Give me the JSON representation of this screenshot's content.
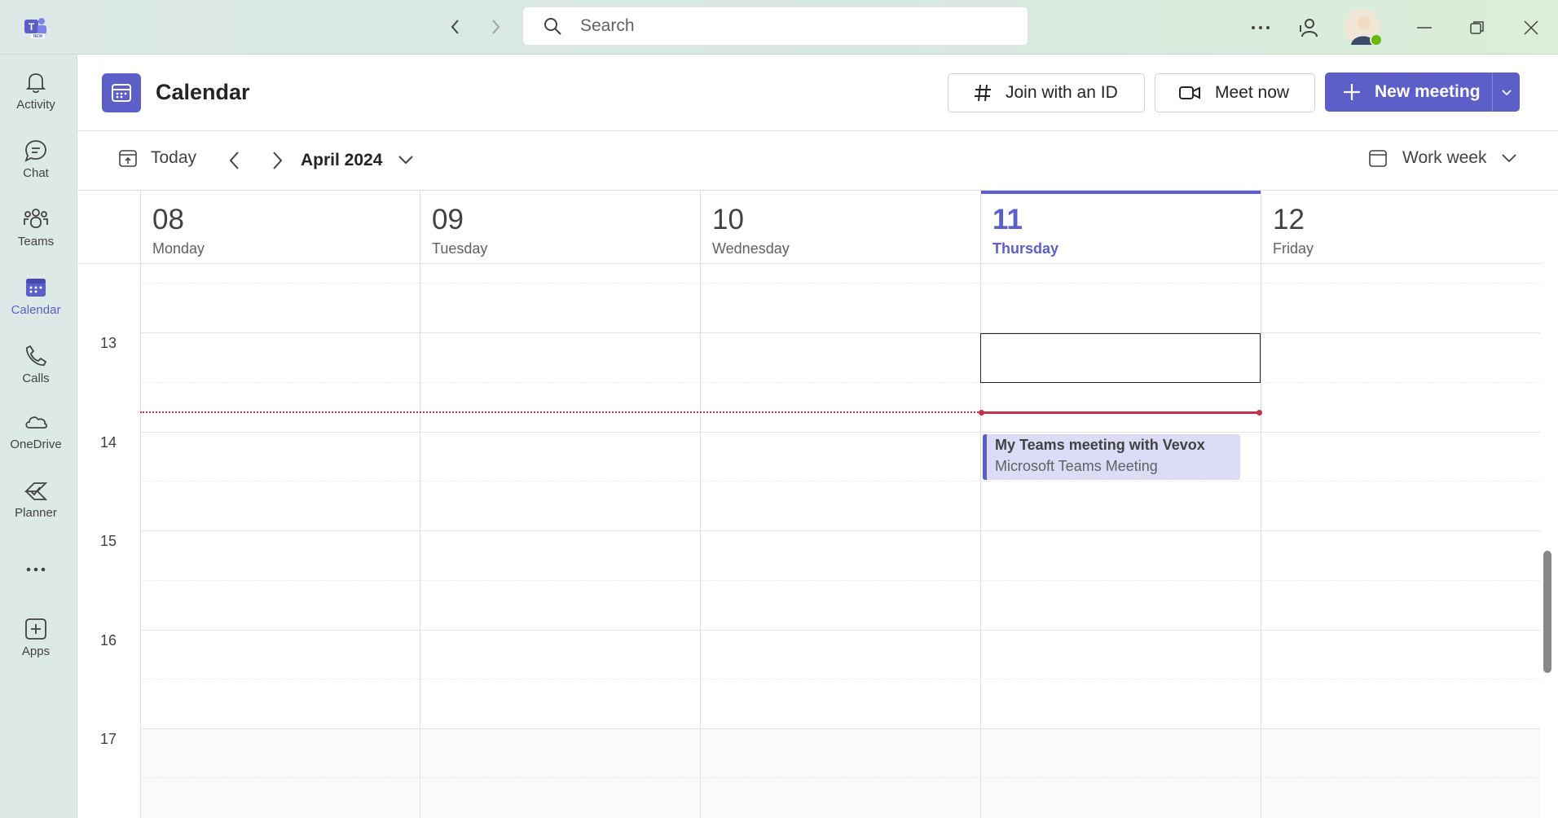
{
  "titlebar": {
    "search_placeholder": "Search"
  },
  "rail": {
    "items": [
      {
        "label": "Activity"
      },
      {
        "label": "Chat"
      },
      {
        "label": "Teams"
      },
      {
        "label": "Calendar"
      },
      {
        "label": "Calls"
      },
      {
        "label": "OneDrive"
      },
      {
        "label": "Planner"
      },
      {
        "label": "Apps"
      }
    ]
  },
  "header": {
    "title": "Calendar",
    "join_label": "Join with an ID",
    "meet_now_label": "Meet now",
    "new_meeting_label": "New meeting"
  },
  "toolbar": {
    "today_label": "Today",
    "month_label": "April 2024",
    "view_label": "Work week"
  },
  "days": [
    {
      "num": "08",
      "name": "Monday"
    },
    {
      "num": "09",
      "name": "Tuesday"
    },
    {
      "num": "10",
      "name": "Wednesday"
    },
    {
      "num": "11",
      "name": "Thursday",
      "today": true
    },
    {
      "num": "12",
      "name": "Friday"
    }
  ],
  "hours": [
    "13",
    "14",
    "15",
    "16",
    "17"
  ],
  "event": {
    "title": "My Teams meeting with Vevox",
    "subtitle": "Microsoft Teams Meeting"
  },
  "colors": {
    "accent": "#5b5fc7",
    "now_line": "#c4314b",
    "event_bg": "#dcdcf7"
  }
}
